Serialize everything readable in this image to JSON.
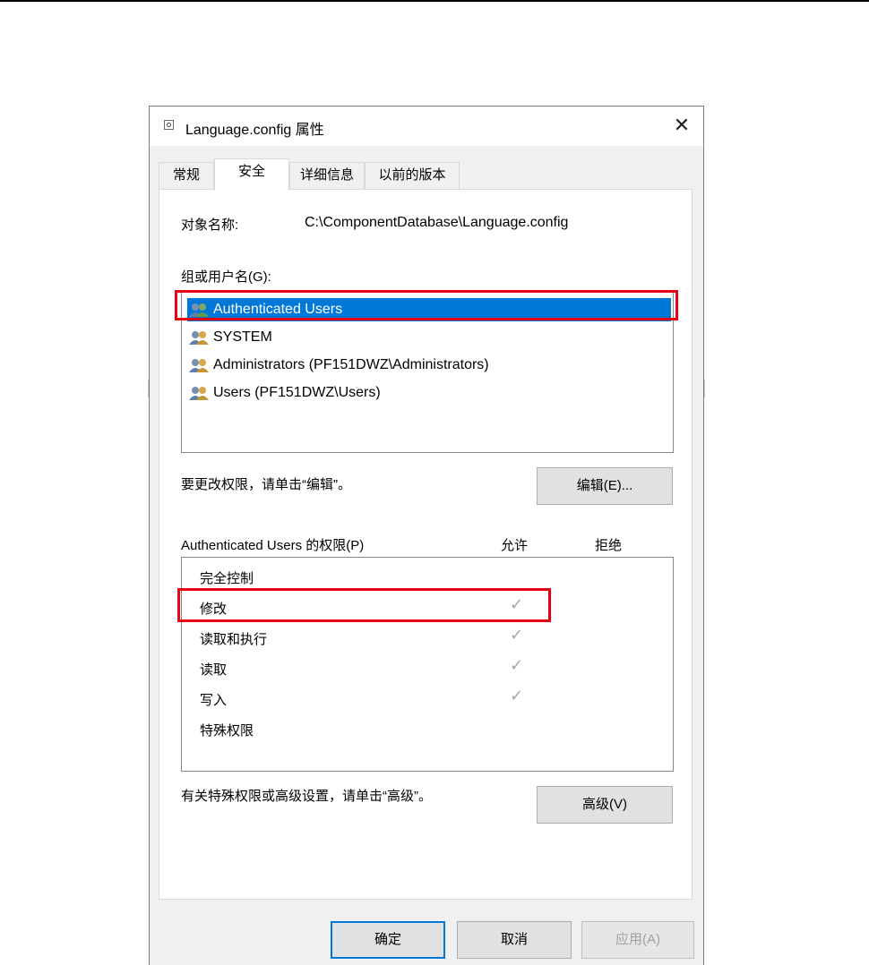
{
  "window": {
    "title": "Language.config 属性",
    "close_glyph": "✕"
  },
  "tabs": [
    {
      "label": "常规"
    },
    {
      "label": "安全"
    },
    {
      "label": "详细信息"
    },
    {
      "label": "以前的版本"
    }
  ],
  "active_tab": "安全",
  "security": {
    "object_name_label": "对象名称:",
    "object_name_value": "C:\\ComponentDatabase\\Language.config",
    "groups_label": "组或用户名(G):",
    "users": [
      {
        "name": "Authenticated Users",
        "selected": true
      },
      {
        "name": "SYSTEM",
        "selected": false
      },
      {
        "name": "Administrators (PF151DWZ\\Administrators)",
        "selected": false
      },
      {
        "name": "Users (PF151DWZ\\Users)",
        "selected": false
      }
    ],
    "edit_hint": "要更改权限，请单击“编辑”。",
    "edit_button": "编辑(E)...",
    "permissions_label": "Authenticated Users 的权限(P)",
    "allow_header": "允许",
    "deny_header": "拒绝",
    "permissions": [
      {
        "name": "完全控制",
        "allow": false,
        "deny": false
      },
      {
        "name": "修改",
        "allow": true,
        "deny": false
      },
      {
        "name": "读取和执行",
        "allow": true,
        "deny": false
      },
      {
        "name": "读取",
        "allow": true,
        "deny": false
      },
      {
        "name": "写入",
        "allow": true,
        "deny": false
      },
      {
        "name": "特殊权限",
        "allow": false,
        "deny": false
      }
    ],
    "check_glyph": "✓",
    "advanced_hint": "有关特殊权限或高级设置，请单击“高级”。",
    "advanced_button": "高级(V)"
  },
  "footer": {
    "ok_button": "确定",
    "cancel_button": "取消",
    "apply_button": "应用(A)"
  },
  "colors": {
    "selection": "#0078d7",
    "highlight_box": "#e60012",
    "check_disabled": "#a6a6a6"
  },
  "icons": [
    "file-config-icon",
    "users-group-icon",
    "close-icon",
    "check-icon"
  ]
}
